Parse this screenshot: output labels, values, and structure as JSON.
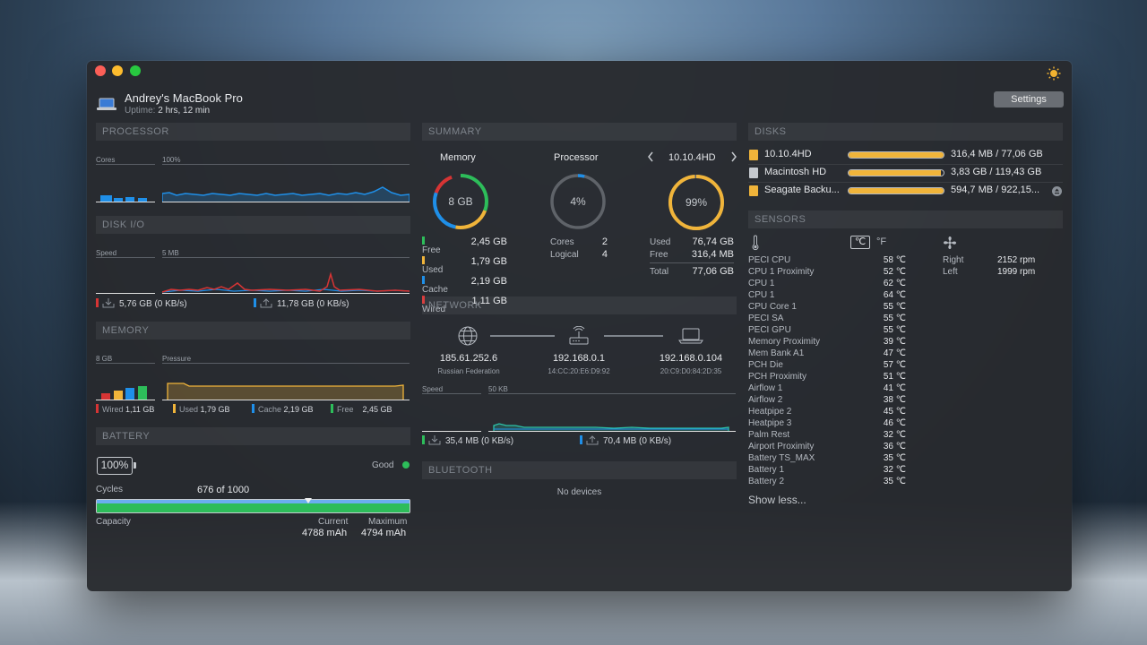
{
  "colors": {
    "free": "#2dbd5a",
    "used": "#f0b43a",
    "cache": "#1f8fe8",
    "wired": "#d63434"
  },
  "header": {
    "machine_name": "Andrey's MacBook Pro",
    "uptime_label": "Uptime:",
    "uptime_value": "2 hrs, 12 min",
    "settings_label": "Settings"
  },
  "processor": {
    "title": "PROCESSOR",
    "cores_label": "Cores",
    "usage_label": "100%"
  },
  "diskio": {
    "title": "DISK I/O",
    "speed_label": "Speed",
    "scale_label": "5 MB",
    "read_total": "5,76 GB (0 KB/s)",
    "write_total": "11,78 GB (0 KB/s)"
  },
  "memory": {
    "title": "MEMORY",
    "total_label": "8 GB",
    "pressure_label": "Pressure",
    "legend": [
      {
        "label": "Wired",
        "value": "1,11 GB"
      },
      {
        "label": "Used",
        "value": "1,79 GB"
      },
      {
        "label": "Cache",
        "value": "2,19 GB"
      },
      {
        "label": "Free",
        "value": "2,45 GB"
      }
    ]
  },
  "battery": {
    "title": "BATTERY",
    "percent": "100%",
    "percent_value": 100,
    "condition": "Good",
    "cycles_label": "Cycles",
    "cycles_value": "676 of 1000",
    "cycles_fraction": 0.676,
    "capacity_label": "Capacity",
    "current_label": "Current",
    "current_value": "4788 mAh",
    "maximum_label": "Maximum",
    "maximum_value": "4794 mAh"
  },
  "summary": {
    "title": "SUMMARY",
    "memory_label": "Memory",
    "memory_center": "8 GB",
    "processor_label": "Processor",
    "processor_center": "4%",
    "processor_value": 4,
    "disk_name": "10.10.4HD",
    "disk_center": "99%",
    "disk_value": 99,
    "memory_rows": [
      {
        "label": "Free",
        "value": "2,45 GB"
      },
      {
        "label": "Used",
        "value": "1,79 GB"
      },
      {
        "label": "Cache",
        "value": "2,19 GB"
      },
      {
        "label": "Wired",
        "value": "1,11 GB"
      }
    ],
    "cpu_rows": [
      {
        "label": "Cores",
        "value": "2"
      },
      {
        "label": "Logical",
        "value": "4"
      }
    ],
    "disk_rows": [
      {
        "label": "Used",
        "value": "76,74 GB"
      },
      {
        "label": "Free",
        "value": "316,4 MB"
      },
      {
        "label": "Total",
        "value": "77,06 GB"
      }
    ]
  },
  "network": {
    "title": "NETWORK",
    "public_ip": "185.61.252.6",
    "public_location": "Russian Federation",
    "router_ip": "192.168.0.1",
    "router_mac": "14:CC:20:E6:D9:92",
    "local_ip": "192.168.0.104",
    "local_mac": "20:C9:D0:84:2D:35",
    "speed_label": "Speed",
    "scale_label": "50 KB",
    "download_total": "35,4 MB (0 KB/s)",
    "upload_total": "70,4 MB (0 KB/s)"
  },
  "bluetooth": {
    "title": "BLUETOOTH",
    "status": "No devices"
  },
  "disks": {
    "title": "DISKS",
    "items": [
      {
        "name": "10.10.4HD",
        "usage": "316,4 MB / 77,06 GB",
        "fill": 0.996
      },
      {
        "name": "Macintosh HD",
        "usage": "3,83 GB / 119,43 GB",
        "fill": 0.968
      },
      {
        "name": "Seagate Backu...",
        "usage": "594,7 MB / 922,15...",
        "fill": 0.999
      }
    ]
  },
  "sensors": {
    "title": "SENSORS",
    "unit_c": "℃",
    "unit_f": "°F",
    "show_less": "Show less...",
    "temps": [
      {
        "name": "PECI CPU",
        "value": "58 ℃"
      },
      {
        "name": "CPU 1 Proximity",
        "value": "52 ℃"
      },
      {
        "name": "CPU 1",
        "value": "62 ℃"
      },
      {
        "name": "CPU 1",
        "value": "64 ℃"
      },
      {
        "name": "CPU Core 1",
        "value": "55 ℃"
      },
      {
        "name": "PECI SA",
        "value": "55 ℃"
      },
      {
        "name": "PECI GPU",
        "value": "55 ℃"
      },
      {
        "name": "Memory Proximity",
        "value": "39 ℃"
      },
      {
        "name": "Mem Bank A1",
        "value": "47 ℃"
      },
      {
        "name": "PCH Die",
        "value": "57 ℃"
      },
      {
        "name": "PCH Proximity",
        "value": "51 ℃"
      },
      {
        "name": "Airflow 1",
        "value": "41 ℃"
      },
      {
        "name": "Airflow 2",
        "value": "38 ℃"
      },
      {
        "name": "Heatpipe 2",
        "value": "45 ℃"
      },
      {
        "name": "Heatpipe 3",
        "value": "46 ℃"
      },
      {
        "name": "Palm Rest",
        "value": "32 ℃"
      },
      {
        "name": "Airport Proximity",
        "value": "36 ℃"
      },
      {
        "name": "Battery TS_MAX",
        "value": "35 ℃"
      },
      {
        "name": "Battery 1",
        "value": "32 ℃"
      },
      {
        "name": "Battery 2",
        "value": "35 ℃"
      }
    ],
    "fans": [
      {
        "name": "Right",
        "value": "2152 rpm"
      },
      {
        "name": "Left",
        "value": "1999 rpm"
      }
    ]
  }
}
